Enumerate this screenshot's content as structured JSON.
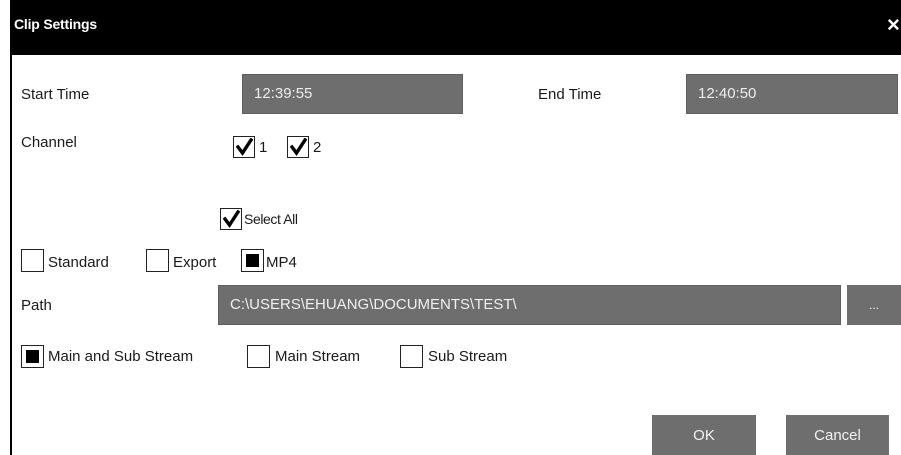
{
  "dialog": {
    "title": "Clip Settings",
    "close_glyph": "×"
  },
  "time": {
    "start_label": "Start Time",
    "start_value": "12:39:55",
    "end_label": "End Time",
    "end_value": "12:40:50"
  },
  "channel": {
    "label": "Channel",
    "items": [
      {
        "label": "1",
        "checked": true
      },
      {
        "label": "2",
        "checked": true
      }
    ],
    "select_all_label": "Select All",
    "select_all_checked": true
  },
  "format": {
    "options": [
      {
        "label": "Standard",
        "selected": false
      },
      {
        "label": "Export",
        "selected": false
      },
      {
        "label": "MP4",
        "selected": true
      }
    ]
  },
  "path": {
    "label": "Path",
    "value": "C:\\USERS\\EHUANG\\DOCUMENTS\\TEST\\",
    "browse_label": "..."
  },
  "stream": {
    "options": [
      {
        "label": "Main and Sub Stream",
        "selected": true
      },
      {
        "label": "Main Stream",
        "selected": false
      },
      {
        "label": "Sub Stream",
        "selected": false
      }
    ]
  },
  "actions": {
    "ok_label": "OK",
    "cancel_label": "Cancel"
  },
  "icons": {
    "check": "checkmark-icon",
    "close": "close-icon"
  },
  "colors": {
    "titlebar": "#000000",
    "field_bg": "#6e6e6e",
    "field_text": "#ededed",
    "button_bg": "#6e6e6e"
  }
}
